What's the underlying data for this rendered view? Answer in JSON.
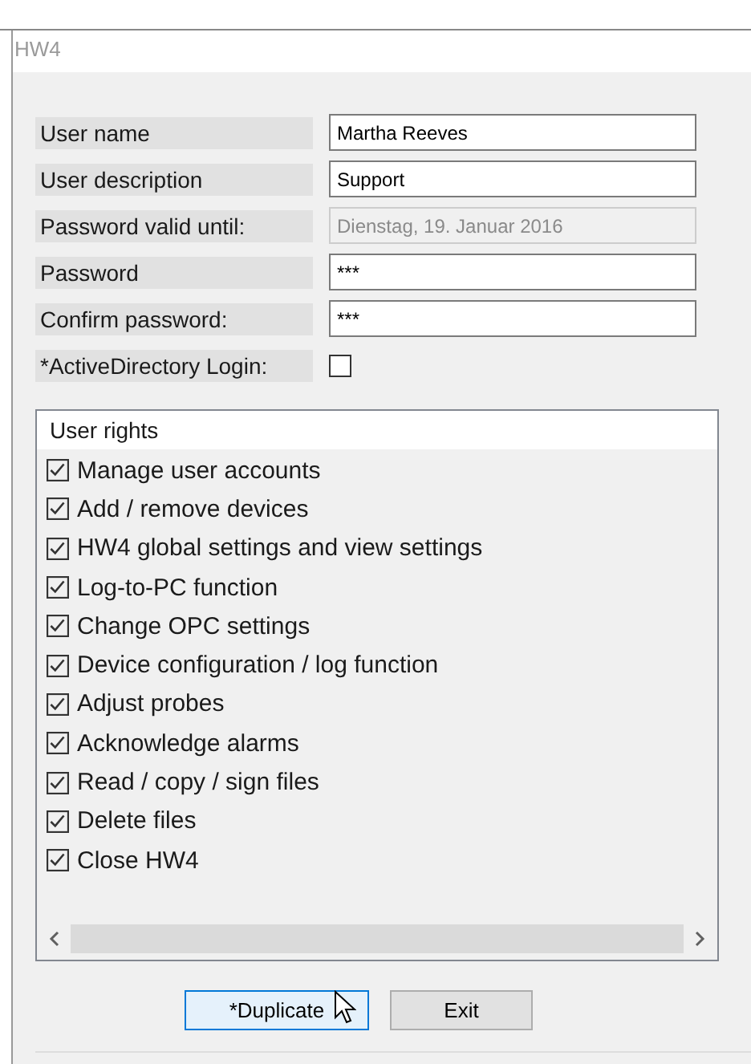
{
  "window": {
    "title": "HW4"
  },
  "fields": [
    {
      "label": "User name",
      "kind": "text",
      "value": "Martha Reeves",
      "disabled": false
    },
    {
      "label": "User description",
      "kind": "text",
      "value": "Support",
      "disabled": false
    },
    {
      "label": "Password valid until:",
      "kind": "text",
      "value": "Dienstag, 19. Januar 2016",
      "disabled": true
    },
    {
      "label": "Password",
      "kind": "text",
      "value": "***",
      "disabled": false
    },
    {
      "label": "Confirm password:",
      "kind": "text",
      "value": "***",
      "disabled": false
    },
    {
      "label": "*ActiveDirectory Login:",
      "kind": "checkbox",
      "checked": false
    }
  ],
  "rights": {
    "title": "User rights",
    "items": [
      {
        "label": "Manage user accounts",
        "checked": true
      },
      {
        "label": "Add / remove devices",
        "checked": true
      },
      {
        "label": "HW4 global settings and view settings",
        "checked": true
      },
      {
        "label": "Log-to-PC function",
        "checked": true
      },
      {
        "label": "Change OPC settings",
        "checked": true
      },
      {
        "label": "Device configuration / log function",
        "checked": true
      },
      {
        "label": "Adjust probes",
        "checked": true
      },
      {
        "label": "Acknowledge alarms",
        "checked": true
      },
      {
        "label": "Read / copy / sign files",
        "checked": true
      },
      {
        "label": "Delete files",
        "checked": true
      },
      {
        "label": "Close HW4",
        "checked": true
      }
    ]
  },
  "buttons": [
    {
      "label": "*Duplicate",
      "focused": true
    },
    {
      "label": "Exit",
      "focused": false
    }
  ]
}
